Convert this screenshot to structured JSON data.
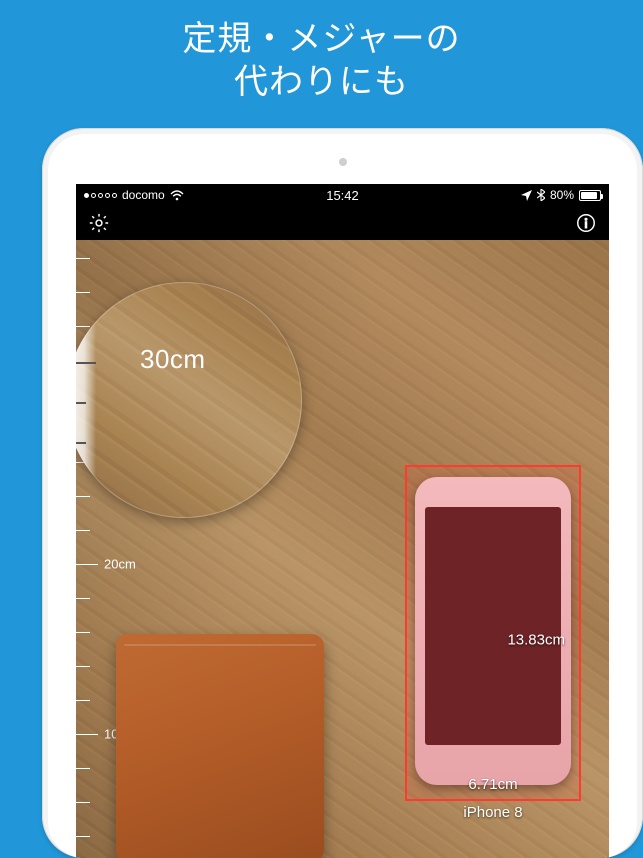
{
  "promo": {
    "line1": "定規・メジャーの",
    "line2": "代わりにも"
  },
  "statusbar": {
    "carrier": "docomo",
    "signal_active_dots": 1,
    "time": "15:42",
    "bluetooth": true,
    "location": true,
    "battery_percent_text": "80%",
    "battery_fill_pct": 80
  },
  "toolbar": {
    "settings_icon": "gear-icon",
    "info_icon": "info-icon"
  },
  "ruler": {
    "labels": {
      "l10": "10cm",
      "l20": "20cm",
      "l30": "30cm"
    }
  },
  "magnifier": {
    "label": "30cm"
  },
  "measurement": {
    "height": "13.83cm",
    "width": "6.71cm",
    "object_name": "iPhone 8"
  }
}
